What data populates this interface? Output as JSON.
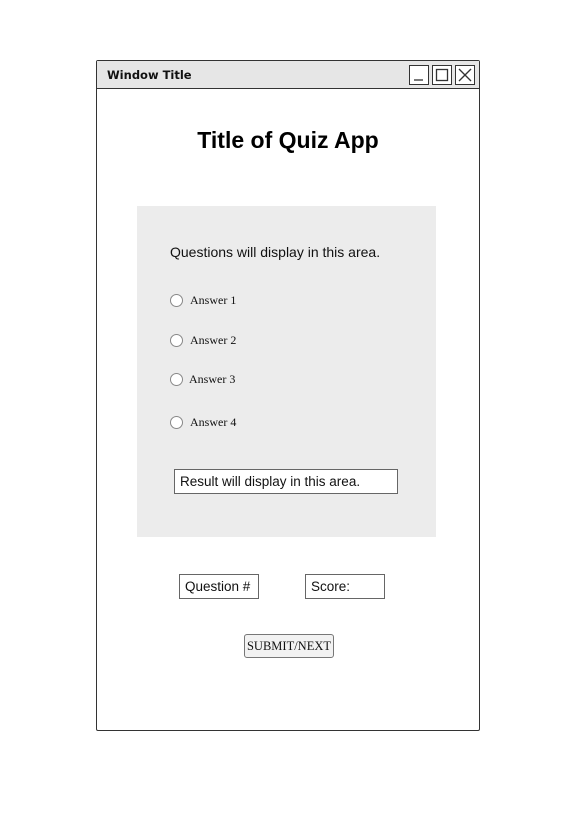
{
  "window": {
    "title": "Window Title",
    "controls": [
      "minimize-icon",
      "maximize-icon",
      "close-icon"
    ]
  },
  "app": {
    "title": "Title of Quiz App"
  },
  "question_panel": {
    "question_text": "Questions will display in this area.",
    "answers": [
      {
        "label": "Answer 1",
        "selected": false
      },
      {
        "label": "Answer 2",
        "selected": false
      },
      {
        "label": "Answer 3",
        "selected": false
      },
      {
        "label": "Answer 4",
        "selected": false
      }
    ],
    "result_text": "Result will display in this area."
  },
  "status": {
    "question_number_label": "Question #",
    "score_label": "Score:"
  },
  "actions": {
    "submit_label": "SUBMIT/NEXT"
  },
  "colors": {
    "panel_background": "#ececec",
    "titlebar_background": "#e6e6e6",
    "border": "#333333"
  }
}
